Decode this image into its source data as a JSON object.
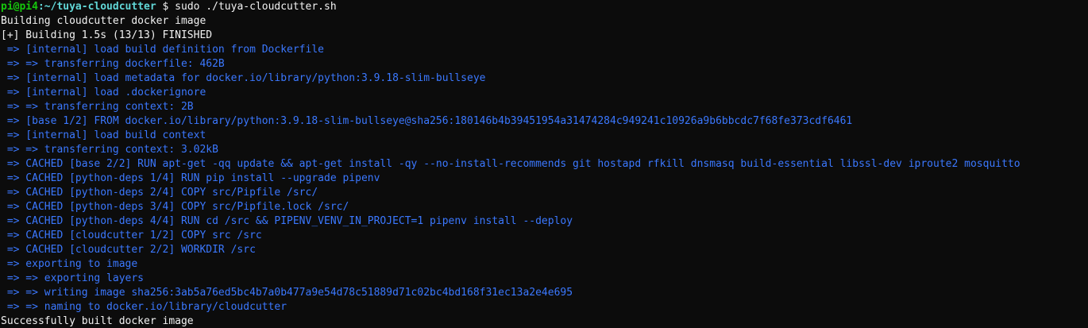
{
  "terminal": {
    "prompt": {
      "user_host": "pi@pi4",
      "path": ":~/tuya-cloudcutter",
      "symbol": " $ ",
      "command": "sudo ./tuya-cloudcutter.sh"
    },
    "header_lines": [
      "Building cloudcutter docker image",
      "[+] Building 1.5s (13/13) FINISHED"
    ],
    "log_lines": [
      " => [internal] load build definition from Dockerfile",
      " => => transferring dockerfile: 462B",
      " => [internal] load metadata for docker.io/library/python:3.9.18-slim-bullseye",
      " => [internal] load .dockerignore",
      " => => transferring context: 2B",
      " => [base 1/2] FROM docker.io/library/python:3.9.18-slim-bullseye@sha256:180146b4b39451954a31474284c949241c10926a9b6bbcdc7f68fe373cdf6461",
      " => [internal] load build context",
      " => => transferring context: 3.02kB",
      " => CACHED [base 2/2] RUN apt-get -qq update && apt-get install -qy --no-install-recommends git hostapd rfkill dnsmasq build-essential libssl-dev iproute2 mosquitto",
      " => CACHED [python-deps 1/4] RUN pip install --upgrade pipenv",
      " => CACHED [python-deps 2/4] COPY src/Pipfile /src/",
      " => CACHED [python-deps 3/4] COPY src/Pipfile.lock /src/",
      " => CACHED [python-deps 4/4] RUN cd /src && PIPENV_VENV_IN_PROJECT=1 pipenv install --deploy",
      " => CACHED [cloudcutter 1/2] COPY src /src",
      " => CACHED [cloudcutter 2/2] WORKDIR /src",
      " => exporting to image",
      " => => exporting layers",
      " => => writing image sha256:3ab5a76ed5bc4b7a0b477a9e54d78c51889d71c02bc4bd168f31ec13a2e4e695",
      " => => naming to docker.io/library/cloudcutter"
    ],
    "footer_line": "Successfully built docker image",
    "colors": {
      "background": "#0c0c0c",
      "text": "#f2f2f2",
      "log": "#3b78ff",
      "prompt_user": "#16c60c",
      "prompt_path": "#61d6d6"
    }
  }
}
